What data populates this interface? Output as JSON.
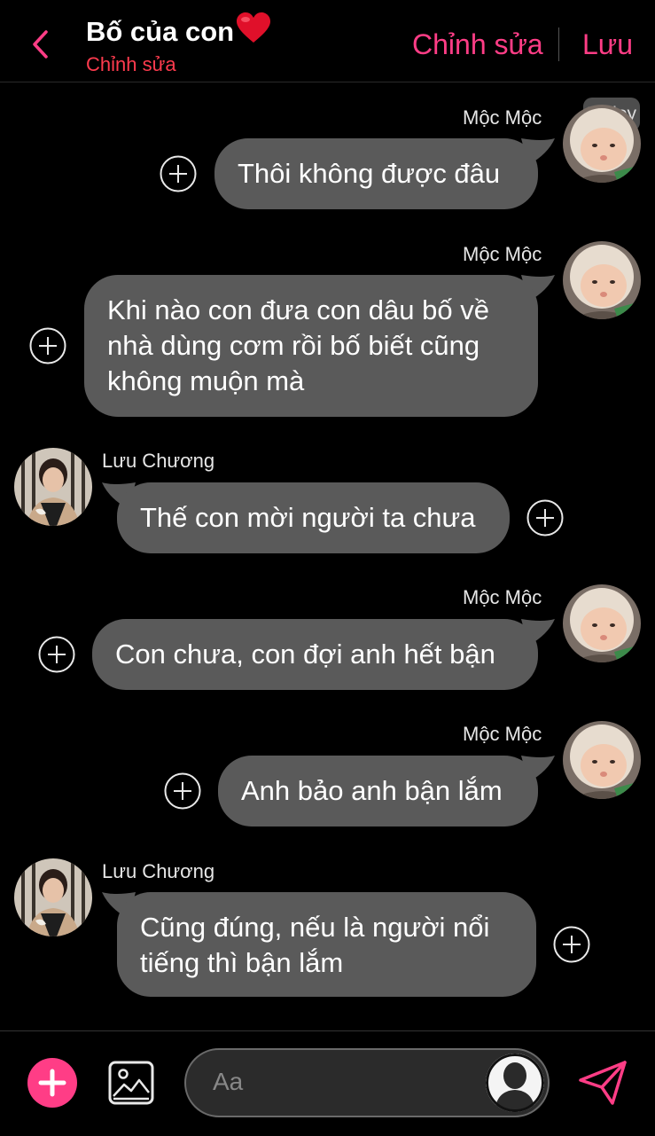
{
  "header": {
    "title": "Bố của con",
    "subtitle": "Chỉnh sửa",
    "edit_label": "Chỉnh sửa",
    "save_label": "Lưu",
    "back_icon": "chevron-left-icon",
    "accent_color": "#ff3d86",
    "subtitle_color": "#ff3b4e"
  },
  "timestamp_chip": "51 joy",
  "messages": [
    {
      "sender": "Mộc Mộc",
      "side": "right",
      "text": "Thôi không được đâu"
    },
    {
      "sender": "Mộc Mộc",
      "side": "right",
      "lines": [
        "Khi nào con đưa con dâu bố về",
        "nhà dùng cơm rồi bố biết cũng",
        "không muộn mà"
      ]
    },
    {
      "sender": "Lưu Chương",
      "side": "left",
      "text": "Thế con mời người ta chưa"
    },
    {
      "sender": "Mộc Mộc",
      "side": "right",
      "text": "Con chưa, con đợi anh hết bận"
    },
    {
      "sender": "Mộc Mộc",
      "side": "right",
      "text": "Anh bảo anh bận lắm"
    },
    {
      "sender": "Lưu Chương",
      "side": "left",
      "lines": [
        "Cũng đúng, nếu là người nổi",
        "tiếng thì bận lắm"
      ]
    }
  ],
  "composer": {
    "placeholder": "Aa",
    "add_icon": "plus-icon",
    "image_icon": "image-icon",
    "send_icon": "send-icon"
  }
}
